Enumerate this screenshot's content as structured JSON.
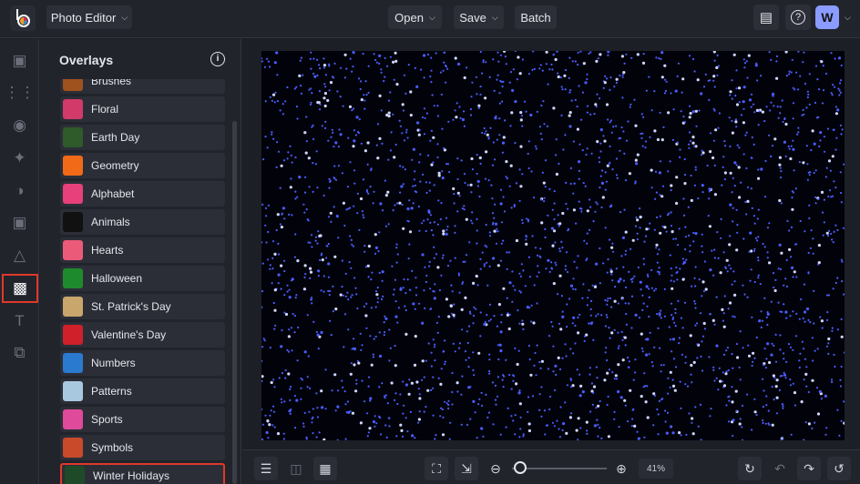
{
  "topbar": {
    "app_menu": "Photo Editor",
    "open": "Open",
    "save": "Save",
    "batch": "Batch",
    "avatar_initial": "W"
  },
  "panel": {
    "title": "Overlays",
    "items": [
      {
        "label": "Brushes",
        "thumb": "#a0521e"
      },
      {
        "label": "Floral",
        "thumb": "#d23a6a"
      },
      {
        "label": "Earth Day",
        "thumb": "#2f5a2a"
      },
      {
        "label": "Geometry",
        "thumb": "#f06a18"
      },
      {
        "label": "Alphabet",
        "thumb": "#e8407a"
      },
      {
        "label": "Animals",
        "thumb": "#111111"
      },
      {
        "label": "Hearts",
        "thumb": "#ec5a7a"
      },
      {
        "label": "Halloween",
        "thumb": "#1e8a2e"
      },
      {
        "label": "St. Patrick's Day",
        "thumb": "#c9a66b"
      },
      {
        "label": "Valentine's Day",
        "thumb": "#d0202a"
      },
      {
        "label": "Numbers",
        "thumb": "#2a7ad0"
      },
      {
        "label": "Patterns",
        "thumb": "#a8c8e0"
      },
      {
        "label": "Sports",
        "thumb": "#e04a9a"
      },
      {
        "label": "Symbols",
        "thumb": "#c84a2a"
      },
      {
        "label": "Winter Holidays",
        "thumb": "#1f4a2a"
      }
    ],
    "selected": "Winter Holidays"
  },
  "bottombar": {
    "zoom": "41%"
  },
  "colors": {
    "accent": "#e0382a",
    "avatar": "#8a9cff",
    "dots": "#4a5cff"
  }
}
